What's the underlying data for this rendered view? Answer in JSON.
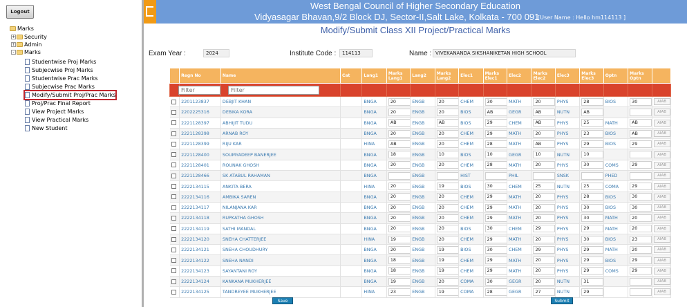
{
  "sidebar": {
    "logout_label": "Logout",
    "tree": {
      "root": "Marks",
      "folders": [
        "Security",
        "Admin",
        "Marks"
      ],
      "items": [
        "Studentwise Proj Marks",
        "Subjecwise Proj Marks",
        "Studentwise Prac Marks",
        "Subjecwise Prac Marks",
        "Modify/Submit Proj/Prac Marks",
        "Proj/Prac Final Report",
        "View Project Marks",
        "View Practical Marks",
        "New Student"
      ]
    }
  },
  "header": {
    "title": "West Bengal Council of Higher Secondary Education",
    "address": "Vidyasagar Bhavan,9/2 Block DJ, Sector-II,Salt Lake, Kolkata - 700 091",
    "user": "[User Name : Hello hm114113 ]",
    "colors": {
      "bar": "#6e9bd8",
      "icon": "#f19a15"
    }
  },
  "page_title": "Modify/Submit Class XII Project/Practical Marks",
  "info": {
    "exam_year_label": "Exam Year :",
    "exam_year": "2024",
    "institute_code_label": "Institute Code :",
    "institute_code": "114113",
    "name_label": "Name :",
    "name": "VIVEKANANDA SIKSHANIKETAN HIGH SCHOOL"
  },
  "table": {
    "headers": [
      "",
      "Regn No",
      "Name",
      "Cat",
      "Lang1",
      "Marks Lang1",
      "Lang2",
      "Marks Lang2",
      "Elec1",
      "Marks Elec1",
      "Elec2",
      "Marks Elec2",
      "Elec3",
      "Marks Elec3",
      "Optn",
      "Marks Optn",
      ""
    ],
    "filter_placeholder": "Filter",
    "action_label": "AIAB",
    "rows": [
      [
        "2201123837",
        "DEBJIT KHAN",
        "BNGA",
        "20",
        "ENGB",
        "20",
        "CHEM",
        "30",
        "MATH",
        "20",
        "PHYS",
        "28",
        "BIOS",
        "30"
      ],
      [
        "2202225316",
        "DEBIKA KORA",
        "BNGA",
        "20",
        "ENGB",
        "20",
        "BIOS",
        "AB",
        "GEGR",
        "AB",
        "NUTN",
        "AB",
        "",
        ""
      ],
      [
        "2221128397",
        "ABHIJIT TUDU",
        "BNGA",
        "AB",
        "ENGB",
        "AB",
        "BIOS",
        "29",
        "CHEM",
        "AB",
        "PHYS",
        "25",
        "MATH",
        "AB"
      ],
      [
        "2221128398",
        "ARNAB ROY",
        "BNGA",
        "20",
        "ENGB",
        "20",
        "CHEM",
        "29",
        "MATH",
        "20",
        "PHYS",
        "23",
        "BIOS",
        "AB"
      ],
      [
        "2221128399",
        "RIJU KAR",
        "HINA",
        "AB",
        "ENGB",
        "20",
        "CHEM",
        "28",
        "MATH",
        "AB",
        "PHYS",
        "29",
        "BIOS",
        "29"
      ],
      [
        "2221128400",
        "SOUMYADEEP BANERJEE",
        "BNGA",
        "18",
        "ENGB",
        "10",
        "BIOS",
        "10",
        "GEGR",
        "10",
        "NUTN",
        "10",
        "",
        ""
      ],
      [
        "2221128401",
        "ROUNAK GHOSH",
        "BNGA",
        "20",
        "ENGB",
        "20",
        "CHEM",
        "28",
        "MATH",
        "20",
        "PHYS",
        "30",
        "COMS",
        "29"
      ],
      [
        "2221128466",
        "SK ATABUL RAHAMAN",
        "BNGA",
        "",
        "ENGB",
        "",
        "HIST",
        "",
        "PHIL",
        "",
        "SNSK",
        "",
        "PHED",
        ""
      ],
      [
        "2222134115",
        "ANKITA BERA",
        "HINA",
        "20",
        "ENGB",
        "19",
        "BIOS",
        "30",
        "CHEM",
        "25",
        "NUTN",
        "25",
        "COMA",
        "29"
      ],
      [
        "2222134116",
        "AMBIKA SAREN",
        "BNGA",
        "20",
        "ENGB",
        "20",
        "CHEM",
        "29",
        "MATH",
        "20",
        "PHYS",
        "28",
        "BIOS",
        "30"
      ],
      [
        "2222134117",
        "NILANJANA KAR",
        "BNGA",
        "20",
        "ENGB",
        "20",
        "CHEM",
        "29",
        "MATH",
        "20",
        "PHYS",
        "30",
        "BIOS",
        "30"
      ],
      [
        "2222134118",
        "RUPKATHA GHOSH",
        "BNGA",
        "20",
        "ENGB",
        "20",
        "CHEM",
        "29",
        "MATH",
        "20",
        "PHYS",
        "30",
        "MATH",
        "20"
      ],
      [
        "2222134119",
        "SATHI MANDAL",
        "BNGA",
        "20",
        "ENGB",
        "20",
        "BIOS",
        "30",
        "CHEM",
        "29",
        "PHYS",
        "29",
        "MATH",
        "20"
      ],
      [
        "2222134120",
        "SNEHA CHATTERJEE",
        "HINA",
        "19",
        "ENGB",
        "20",
        "CHEM",
        "29",
        "MATH",
        "20",
        "PHYS",
        "30",
        "BIOS",
        "23"
      ],
      [
        "2222134121",
        "SNEHA CHOUDHURY",
        "BNGA",
        "20",
        "ENGB",
        "19",
        "BIOS",
        "30",
        "CHEM",
        "29",
        "PHYS",
        "29",
        "MATH",
        "20"
      ],
      [
        "2222134122",
        "SNEHA NANDI",
        "BNGA",
        "18",
        "ENGB",
        "19",
        "CHEM",
        "29",
        "MATH",
        "20",
        "PHYS",
        "29",
        "BIOS",
        "29"
      ],
      [
        "2222134123",
        "SAYANTANI ROY",
        "BNGA",
        "18",
        "ENGB",
        "19",
        "CHEM",
        "29",
        "MATH",
        "20",
        "PHYS",
        "29",
        "COMS",
        "29"
      ],
      [
        "2222134124",
        "KANKANA MUKHERJEE",
        "BNGA",
        "19",
        "ENGB",
        "20",
        "COMA",
        "30",
        "GEGR",
        "20",
        "NUTN",
        "31",
        "",
        ""
      ],
      [
        "2222134125",
        "TANDREYEE MUKHERJEE",
        "HINA",
        "23",
        "ENGB",
        "19",
        "COMA",
        "28",
        "GEGR",
        "27",
        "NUTN",
        "29",
        "",
        ""
      ]
    ]
  },
  "buttons": {
    "save": "Save",
    "submit": "Submit"
  }
}
